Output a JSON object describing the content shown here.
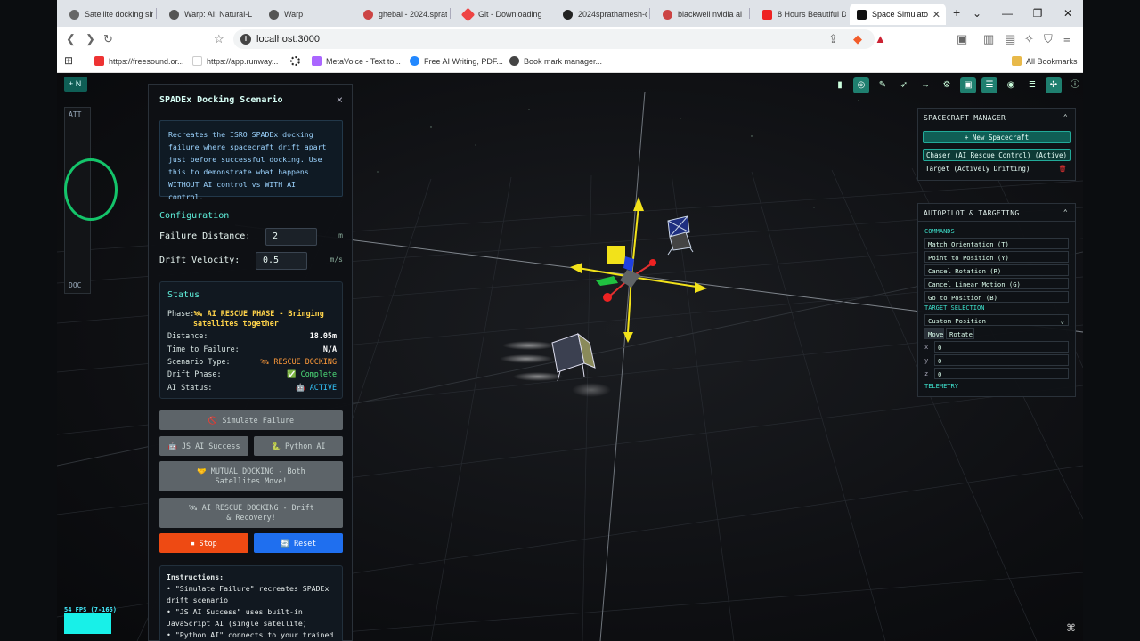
{
  "browser": {
    "tabs": [
      {
        "label": "Satellite docking sim",
        "color": "#666"
      },
      {
        "label": "Warp: AI: Natural-L",
        "color": "#555"
      },
      {
        "label": "Warp",
        "color": "#555"
      },
      {
        "label": "ghebai - 2024.sprat",
        "color": "#c44"
      },
      {
        "label": "Git - Downloading",
        "color": "#e44"
      },
      {
        "label": "2024sprathamesh-c",
        "color": "#222"
      },
      {
        "label": "blackwell nvidia ai",
        "color": "#c44"
      },
      {
        "label": "8 Hours Beautiful D",
        "color": "#e22"
      },
      {
        "label": "Space Simulato",
        "color": "#111"
      }
    ],
    "new_tab": "+",
    "url": "localhost:3000",
    "bookmarks": [
      {
        "label": "https://freesound.or...",
        "color": "#e33"
      },
      {
        "label": "https://app.runway...",
        "color": "#fff"
      },
      {
        "label": "",
        "color": "#222"
      },
      {
        "label": "MetaVoice - Text to...",
        "color": "#a6f"
      },
      {
        "label": "Free AI Writing, PDF...",
        "color": "#28f"
      },
      {
        "label": "Book mark manager...",
        "color": "#444"
      }
    ],
    "all_bookmarks": "All Bookmarks"
  },
  "app": {
    "new_button": "+ N",
    "attitude_title": "ATT",
    "docking_label": "DOC",
    "fps": "54 FPS (7-165)"
  },
  "spadex": {
    "title": "SPADEx Docking Scenario",
    "close": "×",
    "description": "Recreates the ISRO SPADEx docking failure where spacecraft drift apart just before successful docking. Use this to demonstrate what happens WITHOUT AI control vs WITH AI control.",
    "config_title": "Configuration",
    "failure_distance_label": "Failure Distance:",
    "failure_distance_value": "2",
    "failure_distance_unit": "m",
    "drift_velocity_label": "Drift Velocity:",
    "drift_velocity_value": "0.5",
    "drift_velocity_unit": "m/s",
    "status_title": "Status",
    "phase_label": "Phase:",
    "phase_value": "🛰 AI RESCUE PHASE - Bringing satellites together",
    "distance_label": "Distance:",
    "distance_value": "18.05m",
    "ttf_label": "Time to Failure:",
    "ttf_value": "N/A",
    "scenario_label": "Scenario Type:",
    "scenario_value": "🛰 RESCUE DOCKING",
    "drift_label": "Drift Phase:",
    "drift_value": "✅ Complete",
    "ai_label": "AI Status:",
    "ai_value": "🤖 ACTIVE",
    "btn_simulate": "🚫 Simulate Failure",
    "btn_js": "🤖 JS AI Success",
    "btn_python": "🐍 Python AI",
    "btn_mutual": "🤝 MUTUAL DOCKING - Both Satellites Move!",
    "btn_rescue": "🛰 AI RESCUE DOCKING - Drift & Recovery!",
    "btn_stop": "⏹ Stop",
    "btn_reset": "🔄 Reset",
    "instructions_title": "Instructions:",
    "instr_1": "• \"Simulate Failure\" recreates SPADEx drift scenario",
    "instr_2": "• \"JS AI Success\" uses built-in JavaScript AI (single satellite)",
    "instr_3": "• \"Python AI\" connects to your trained"
  },
  "manager": {
    "title": "SPACECRAFT MANAGER",
    "new": "+ New Spacecraft",
    "chaser": "Chaser (AI Rescue Control) (Active)",
    "target": "Target (Actively Drifting)"
  },
  "autopilot": {
    "title": "AUTOPILOT & TARGETING",
    "commands_label": "COMMANDS",
    "commands": [
      "Match Orientation (T)",
      "Point to Position (Y)",
      "Cancel Rotation (R)",
      "Cancel Linear Motion (G)",
      "Go to Position (B)"
    ],
    "target_label": "TARGET SELECTION",
    "target_select": "Custom Position",
    "move": "Move",
    "rotate": "Rotate",
    "x": "0",
    "y": "0",
    "z": "0",
    "telemetry_label": "TELEMETRY"
  },
  "colors": {
    "accent": "#5ff0dc",
    "stop": "#ee4a13",
    "reset": "#1f6fef"
  }
}
